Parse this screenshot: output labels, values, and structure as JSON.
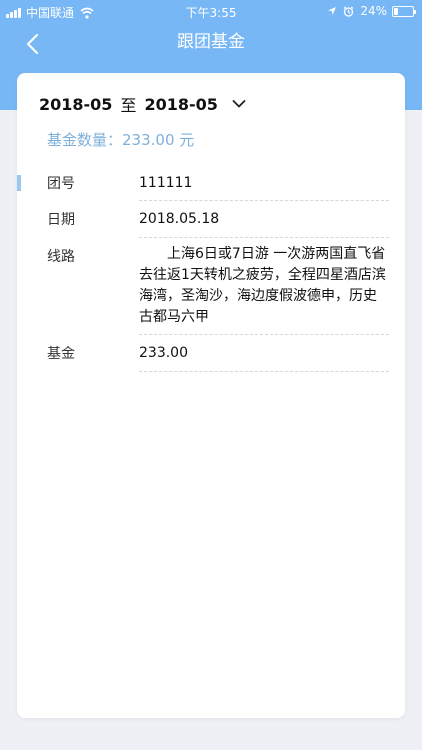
{
  "status_bar": {
    "carrier": "中国联通",
    "time": "下午3:55",
    "battery": "24%",
    "battery_level": 0.24
  },
  "nav": {
    "title": "跟团基金",
    "back_icon": "chevron-left-icon"
  },
  "filter": {
    "start": "2018-05",
    "separator": "至",
    "end": "2018-05",
    "toggle_icon": "chevron-down-icon"
  },
  "summary": {
    "fund_count": "基金数量：233.00 元"
  },
  "record": {
    "rows": [
      {
        "label": "团号",
        "value": "111111"
      },
      {
        "label": "日期",
        "value": "2018.05.18"
      },
      {
        "label": "线路",
        "value": "上海6日或7日游 一次游两国直飞省去往返1天转机之疲劳，全程四星酒店滨海湾，圣淘沙，海边度假波德申，历史古都马六甲"
      },
      {
        "label": "基金",
        "value": "233.00"
      }
    ]
  },
  "colors": {
    "header": "#78b7f5",
    "accent_text": "#7fb0dc",
    "indicator": "#9cc9f2",
    "background": "#eef0f5"
  }
}
